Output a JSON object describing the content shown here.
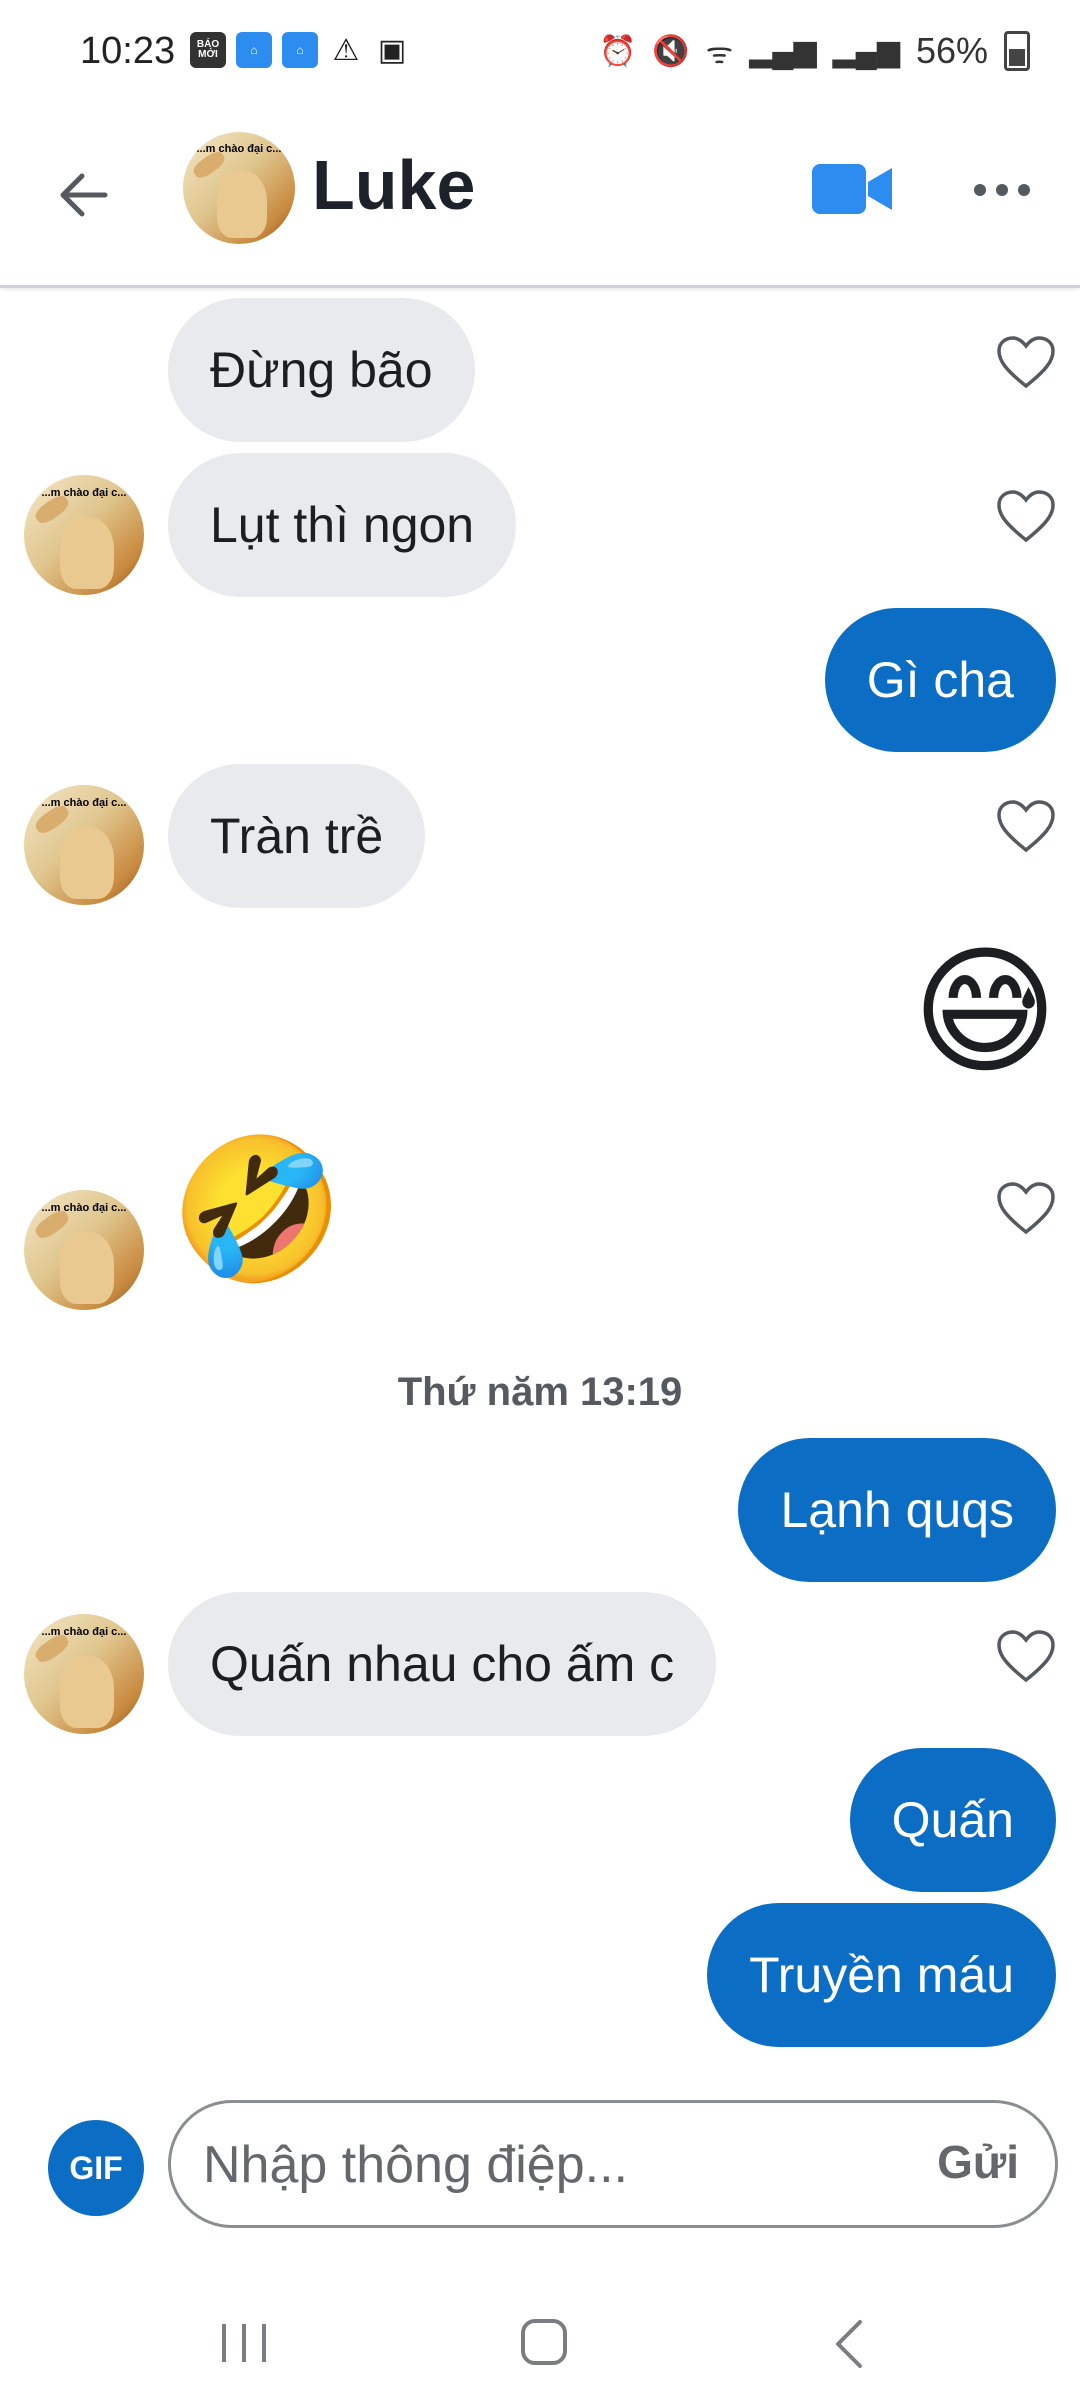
{
  "status_bar": {
    "time": "10:23",
    "left_icons": [
      "baomoi-icon",
      "home-app-icon",
      "home-app-icon",
      "warning-icon",
      "image-icon"
    ],
    "baomoi_label": "BÁO MỚI",
    "battery": "56%"
  },
  "header": {
    "contact_name": "Luke",
    "avatar_caption": "...m chào đại c..."
  },
  "messages": [
    {
      "side": "in",
      "text": "Đừng bão",
      "liked": false
    },
    {
      "side": "in",
      "text": "Lụt thì ngon",
      "liked": false
    },
    {
      "side": "out",
      "text": "Gì cha"
    },
    {
      "side": "in",
      "text": "Tràn trề",
      "liked": false
    },
    {
      "side": "out",
      "emoji": "😅"
    },
    {
      "side": "in",
      "emoji": "🤣",
      "liked": false
    },
    {
      "side": "out",
      "text": "Lạnh quqs"
    },
    {
      "side": "in",
      "text": "Quấn nhau cho ấm c",
      "liked": false
    },
    {
      "side": "out",
      "text": "Quấn"
    },
    {
      "side": "out",
      "text": "Truyền máu"
    }
  ],
  "timestamp": "Thứ năm 13:19",
  "composer": {
    "gif_label": "GIF",
    "placeholder": "Nhập thông điệp...",
    "value": "",
    "send_label": "Gửi"
  },
  "colors": {
    "outgoing_bubble": "#0b6ec4",
    "incoming_bubble": "#e9eaee",
    "accent": "#2d8cf0"
  }
}
